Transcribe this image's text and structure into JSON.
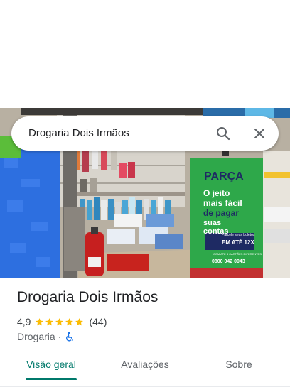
{
  "search": {
    "query": "Drogaria Dois Irmãos",
    "search_icon": "search-icon",
    "clear_icon": "close-icon"
  },
  "place": {
    "title": "Drogaria Dois Irmãos",
    "rating": "4,9",
    "stars": 5,
    "reviews": "(44)",
    "category": "Drogaria",
    "separator": "·",
    "accessibility_icon": "wheelchair-icon"
  },
  "photo_banner": {
    "brand": "PARÇA",
    "line1": "O jeito",
    "line2": "mais fácil",
    "line3": "de pagar",
    "line4": "suas",
    "line5": "contas",
    "installments_prefix": "Parcele seus boletos",
    "installments_badge": "EM ATÉ 12X",
    "cards_note": "COM ATÉ 4 CARTÕES DIFERENTES",
    "phone": "0800 042 0043"
  },
  "tabs": [
    {
      "label": "Visão geral",
      "active": true
    },
    {
      "label": "Avaliações",
      "active": false
    },
    {
      "label": "Sobre",
      "active": false
    }
  ],
  "colors": {
    "accent": "#00796b",
    "star": "#fbbc04",
    "banner_green": "#2ea84a",
    "banner_dark": "#1e2a63"
  }
}
